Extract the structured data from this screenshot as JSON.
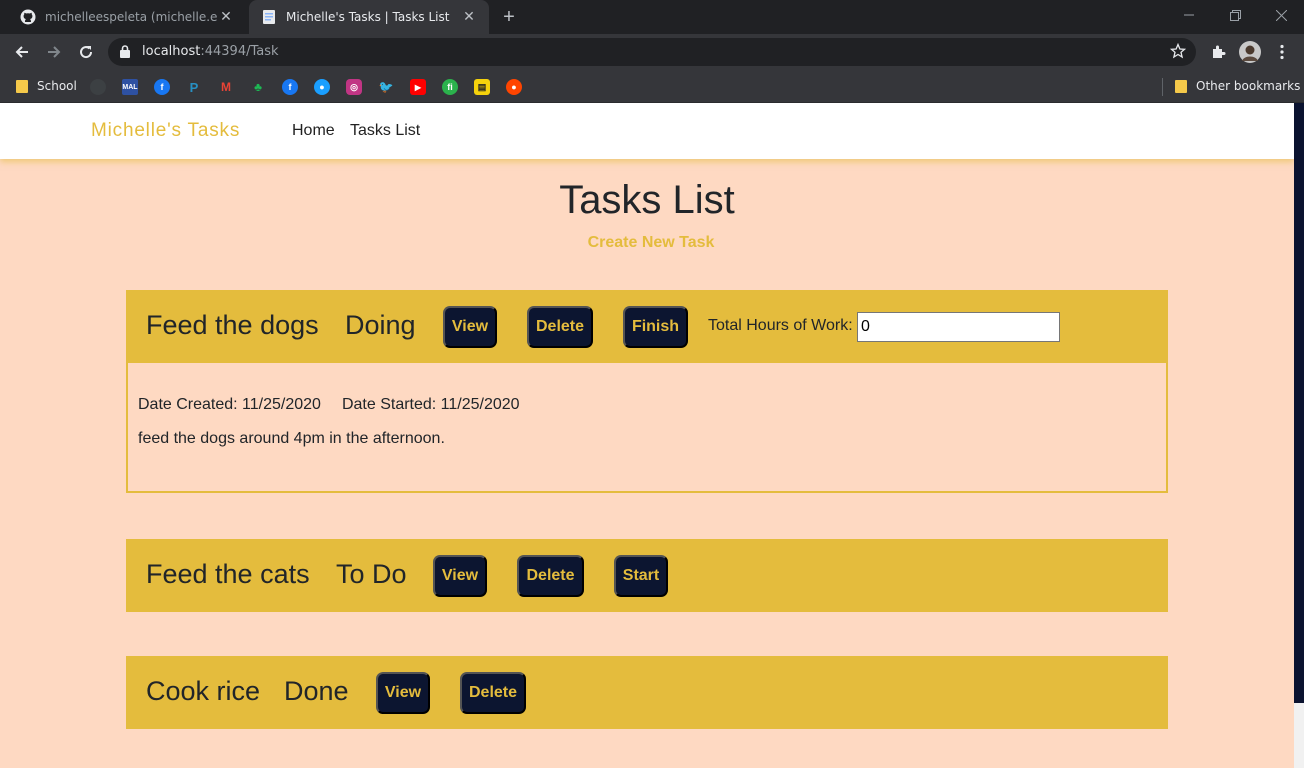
{
  "browser": {
    "tabs": [
      {
        "title": "michelleespeleta (michelle.espele",
        "icon": "github-icon"
      },
      {
        "title": "Michelle's Tasks | Tasks List",
        "icon": "page-icon"
      }
    ],
    "url_host": "localhost",
    "url_rest": ":44394/Task",
    "bookmarks": {
      "school": "School",
      "other": "Other bookmarks",
      "mal": "MAL"
    }
  },
  "site": {
    "brand": "Michelle's Tasks",
    "nav": {
      "home": "Home",
      "tasks_list": "Tasks List"
    }
  },
  "main": {
    "title": "Tasks List",
    "create_link": "Create New Task"
  },
  "tasks": [
    {
      "name": "Feed the dogs",
      "status": "Doing",
      "view": "View",
      "delete": "Delete",
      "action": "Finish",
      "hours_label": "Total Hours of Work:",
      "hours_value": "0",
      "date_created": "Date Created: 11/25/2020",
      "date_started": "Date Started: 11/25/2020",
      "description": "feed the dogs around 4pm in the afternoon."
    },
    {
      "name": "Feed the cats",
      "status": "To Do",
      "view": "View",
      "delete": "Delete",
      "action": "Start"
    },
    {
      "name": "Cook rice",
      "status": "Done",
      "view": "View",
      "delete": "Delete"
    }
  ],
  "colors": {
    "accent": "#e4bc3d",
    "button_bg": "#0c1530",
    "page_bg": "#fed9c2"
  }
}
